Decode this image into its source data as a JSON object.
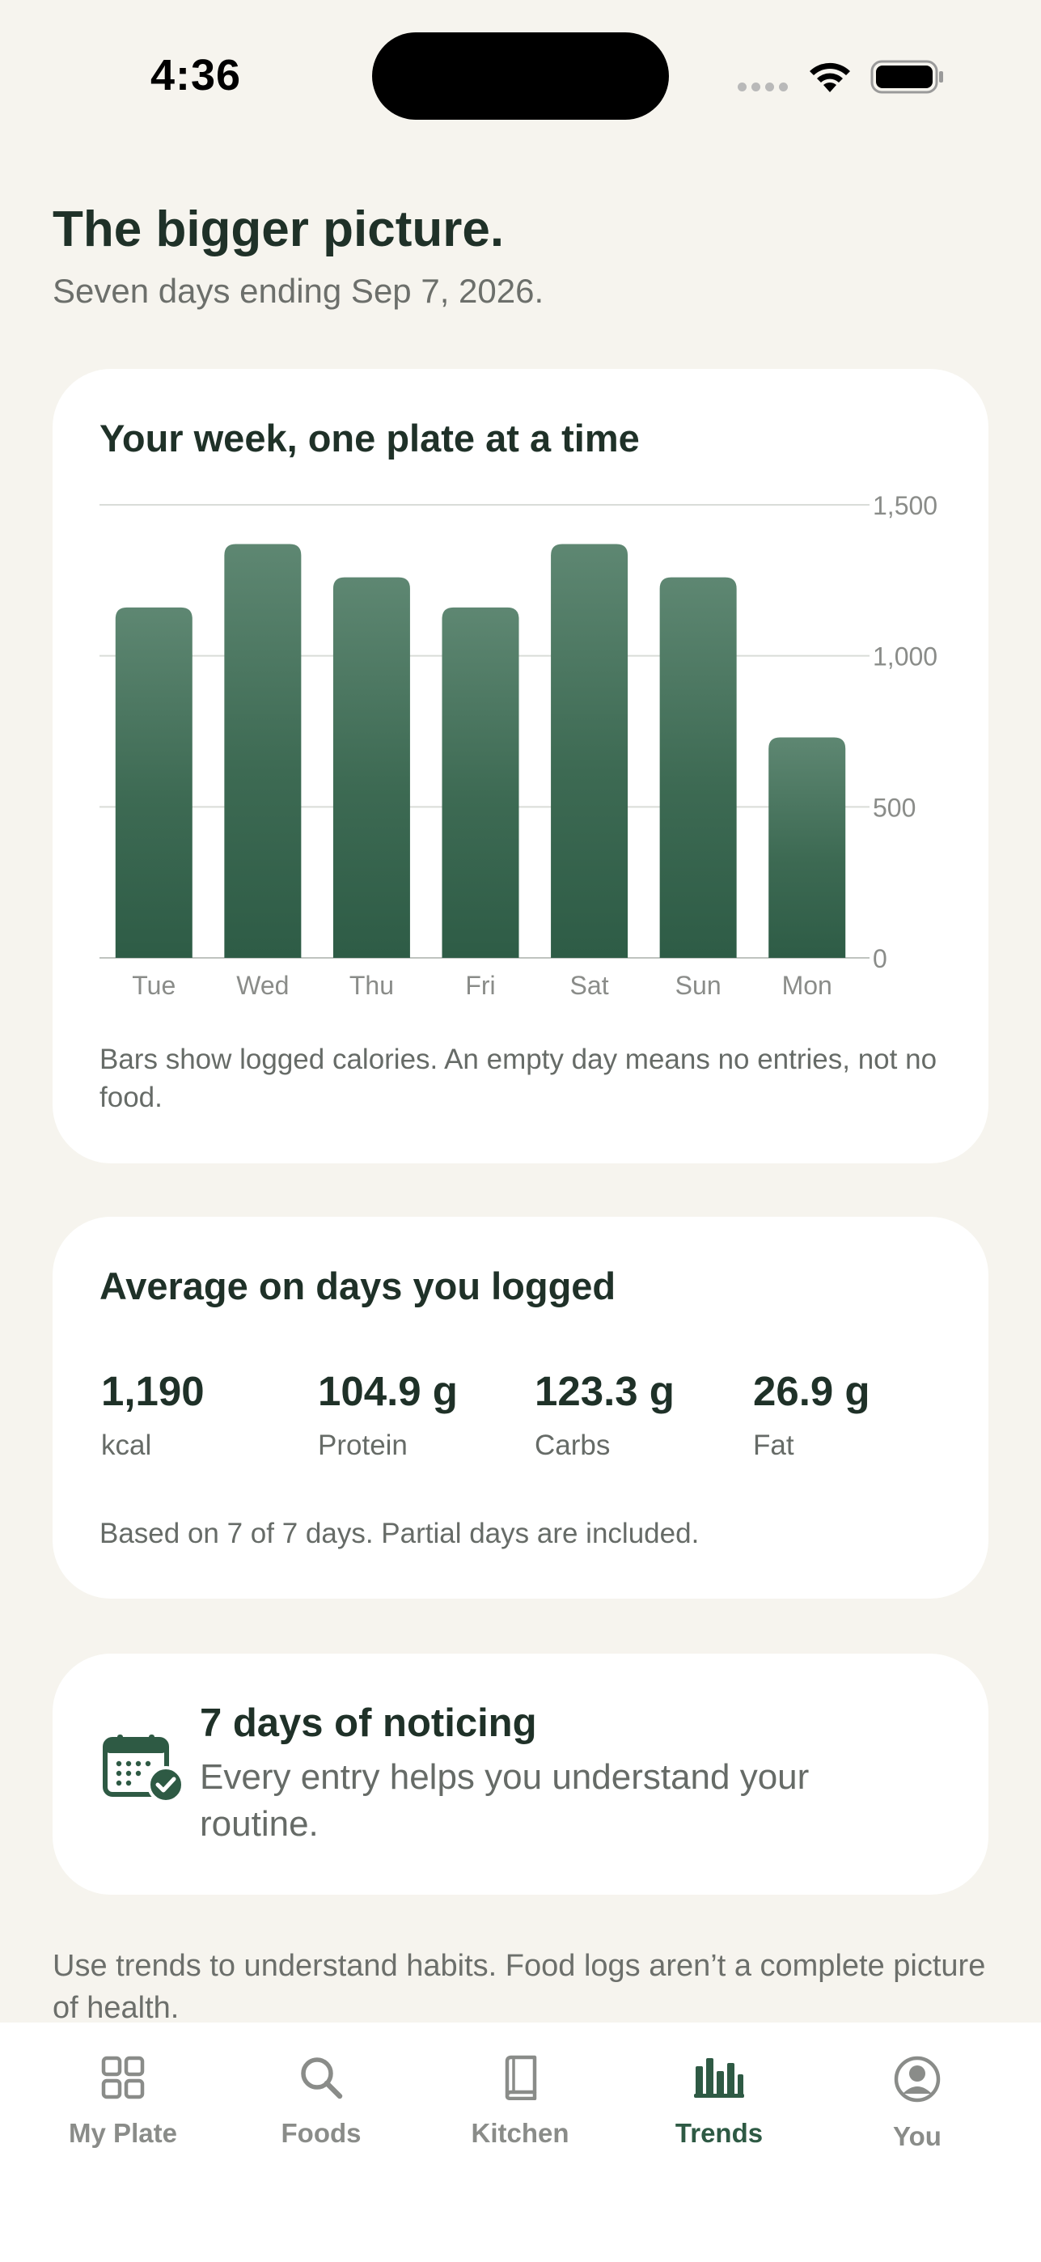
{
  "status_bar": {
    "time": "4:36"
  },
  "header": {
    "title": "The bigger picture.",
    "subtitle": "Seven days ending Sep 7, 2026."
  },
  "weekly_card": {
    "title": "Your week, one plate at a time",
    "note": "Bars show logged calories. An empty day means no entries, not no food."
  },
  "chart_data": {
    "type": "bar",
    "categories": [
      "Tue",
      "Wed",
      "Thu",
      "Fri",
      "Sat",
      "Sun",
      "Mon"
    ],
    "values": [
      1160,
      1370,
      1260,
      1160,
      1370,
      1260,
      730
    ],
    "ylim": [
      0,
      1500
    ],
    "yticks": [
      0,
      500,
      1000,
      1500
    ],
    "ytick_labels": [
      "0",
      "500",
      "1,000",
      "1,500"
    ],
    "grid": true,
    "bar_color_top": "#5e8772",
    "bar_color_bottom": "#2e5c46"
  },
  "average_card": {
    "title": "Average on days you logged",
    "stats": [
      {
        "value": "1,190",
        "label": "kcal"
      },
      {
        "value": "104.9 g",
        "label": "Protein"
      },
      {
        "value": "123.3 g",
        "label": "Carbs"
      },
      {
        "value": "26.9 g",
        "label": "Fat"
      }
    ],
    "note": "Based on 7 of 7 days. Partial days are included."
  },
  "streak_card": {
    "icon": "calendar-check-icon",
    "title": "7 days of noticing",
    "text": "Every entry helps you understand your routine."
  },
  "footer_note": "Use trends to understand habits. Food logs aren’t a complete picture of health.",
  "tab_bar": {
    "active": "Trends",
    "tabs": [
      {
        "label": "My Plate",
        "icon": "grid-icon"
      },
      {
        "label": "Foods",
        "icon": "search-icon"
      },
      {
        "label": "Kitchen",
        "icon": "book-icon"
      },
      {
        "label": "Trends",
        "icon": "bar-chart-icon"
      },
      {
        "label": "You",
        "icon": "profile-icon"
      }
    ]
  },
  "colors": {
    "background": "#f6f4ee",
    "accent": "#2e5a44",
    "text_primary": "#1f3128",
    "text_secondary": "#666b67"
  }
}
